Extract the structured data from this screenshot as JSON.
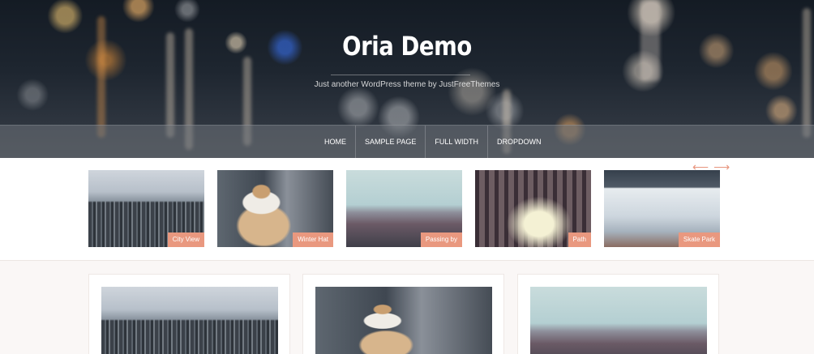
{
  "site": {
    "title": "Oria Demo",
    "tagline": "Just another WordPress theme by JustFreeThemes"
  },
  "nav": {
    "items": [
      {
        "label": "HOME"
      },
      {
        "label": "SAMPLE PAGE"
      },
      {
        "label": "FULL WIDTH"
      },
      {
        "label": "DROPDOWN"
      }
    ]
  },
  "carousel": {
    "prev_icon": "arrow-left-icon",
    "next_icon": "arrow-right-icon",
    "prev_glyph": "⟵",
    "next_glyph": "⟶",
    "slides": [
      {
        "label": "City View"
      },
      {
        "label": "Winter Hat"
      },
      {
        "label": "Passing by"
      },
      {
        "label": "Path"
      },
      {
        "label": "Skate Park"
      }
    ]
  },
  "colors": {
    "accent": "#e9987f",
    "nav_bg": "rgba(110,115,122,0.55)",
    "page_bg": "#faf7f6"
  }
}
